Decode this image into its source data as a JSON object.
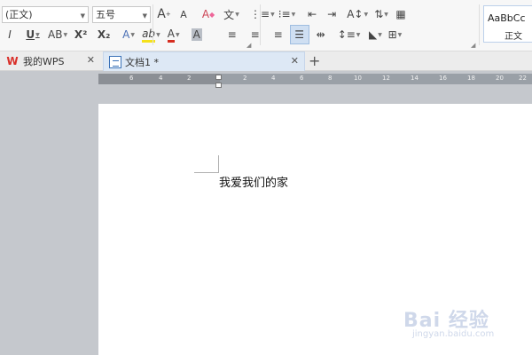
{
  "ribbon": {
    "font_family_value": "(正文)",
    "font_size_value": "五号",
    "grow_font_label": "A",
    "shrink_font_label": "A",
    "clear_format_label": "A",
    "pinyin_label": "文",
    "style_preview_sample": "AaBbCc",
    "style_preview_name": "正文",
    "bold_label": "I",
    "underline_label": "U",
    "strike_label": "AB",
    "superscript_label": "X²",
    "subscript_label": "X₂",
    "text_effect_label": "A",
    "highlight_label": "ab",
    "font_color_label": "A",
    "char_shading_label": "A",
    "font_color_accent": "#d62d20",
    "highlight_accent": "#f5e11b",
    "char_shading_bg": "#b9bec6"
  },
  "tabs": {
    "home_tab_label": "我的WPS",
    "doc_tab_label": "文档1 *"
  },
  "ruler": {
    "ticks": [
      "6",
      "4",
      "2",
      "2",
      "4",
      "6",
      "8",
      "10",
      "12",
      "14",
      "16",
      "18",
      "20",
      "22"
    ]
  },
  "document": {
    "body_text": "我爱我们的家"
  },
  "watermark": {
    "brand": "Bai 经验",
    "url": "jingyan.baidu.com"
  }
}
